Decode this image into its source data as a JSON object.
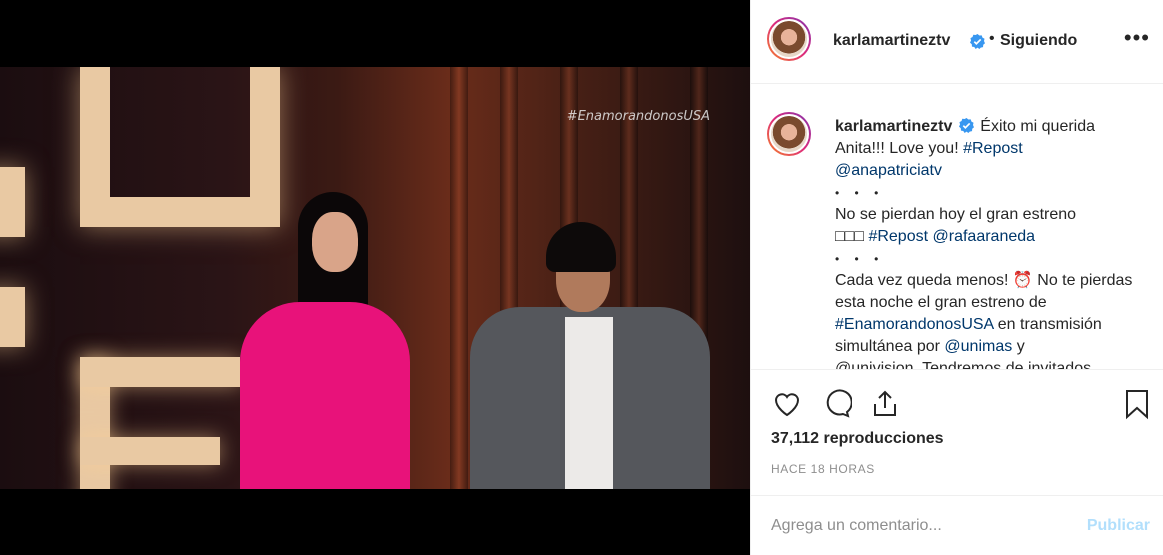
{
  "video": {
    "hashtag_overlay": "#EnamorandonosUSA"
  },
  "header": {
    "username": "karlamartineztv",
    "separator": "•",
    "follow_label": "Siguiendo",
    "more_label": "•••"
  },
  "caption": {
    "username": "karlamartineztv",
    "line1": "Éxito mi querida Anita!!! Love you!",
    "tag_repost1": "#Repost",
    "mention1": "@anapatriciatv",
    "bullets": "• • •",
    "line2": "No se pierdan hoy el gran estreno",
    "emojis": "□□□",
    "tag_repost2": "#Repost",
    "mention2": "@rafaaraneda",
    "line3": "Cada vez queda menos! ⏰ No te pierdas esta noche el gran estreno de",
    "tag_show": "#EnamorandonosUSA",
    "line4": "en transmisión simultánea por",
    "mention3": "@unimas",
    "line5": "y",
    "line6": "@univision. Tendremos de invitados"
  },
  "stats": {
    "views": "37,112 reproducciones",
    "time_ago": "HACE 18 HORAS"
  },
  "comment": {
    "placeholder": "Agrega un comentario...",
    "publish_label": "Publicar"
  },
  "colors": {
    "verified": "#3897f0",
    "link": "#00376b",
    "publish_disabled": "#b2dffc"
  },
  "icons": [
    "heart-icon",
    "comment-icon",
    "share-icon",
    "bookmark-icon",
    "verified-badge-icon",
    "more-options-icon"
  ]
}
